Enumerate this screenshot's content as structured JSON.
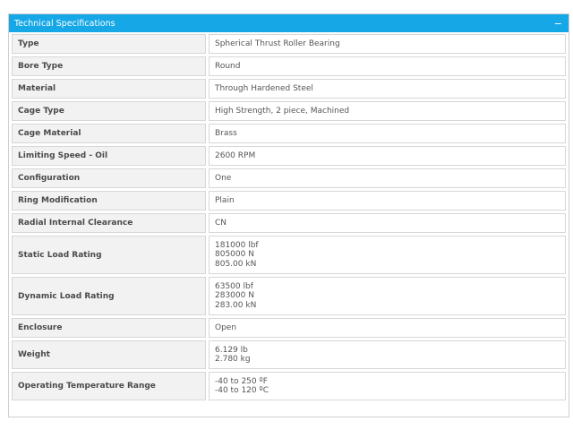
{
  "panel": {
    "title": "Technical Specifications",
    "collapse_symbol": "−"
  },
  "specs": [
    {
      "label": "Type",
      "value": [
        "Spherical Thrust Roller Bearing"
      ]
    },
    {
      "label": "Bore Type",
      "value": [
        "Round"
      ]
    },
    {
      "label": "Material",
      "value": [
        "Through Hardened Steel"
      ]
    },
    {
      "label": "Cage Type",
      "value": [
        "High Strength, 2 piece, Machined"
      ]
    },
    {
      "label": "Cage Material",
      "value": [
        "Brass"
      ]
    },
    {
      "label": "Limiting Speed - Oil",
      "value": [
        "2600 RPM"
      ]
    },
    {
      "label": "Configuration",
      "value": [
        "One"
      ]
    },
    {
      "label": "Ring Modification",
      "value": [
        "Plain"
      ]
    },
    {
      "label": "Radial Internal Clearance",
      "value": [
        "CN"
      ]
    },
    {
      "label": "Static Load Rating",
      "value": [
        "181000 lbf",
        "805000 N",
        "805.00 kN"
      ]
    },
    {
      "label": "Dynamic Load Rating",
      "value": [
        "63500 lbf",
        "283000 N",
        "283.00 kN"
      ]
    },
    {
      "label": "Enclosure",
      "value": [
        "Open"
      ]
    },
    {
      "label": "Weight",
      "value": [
        "6.129 lb",
        "2.780 kg"
      ]
    },
    {
      "label": "Operating Temperature Range",
      "value": [
        "-40 to 250 ºF",
        "-40 to 120 ºC"
      ]
    }
  ]
}
